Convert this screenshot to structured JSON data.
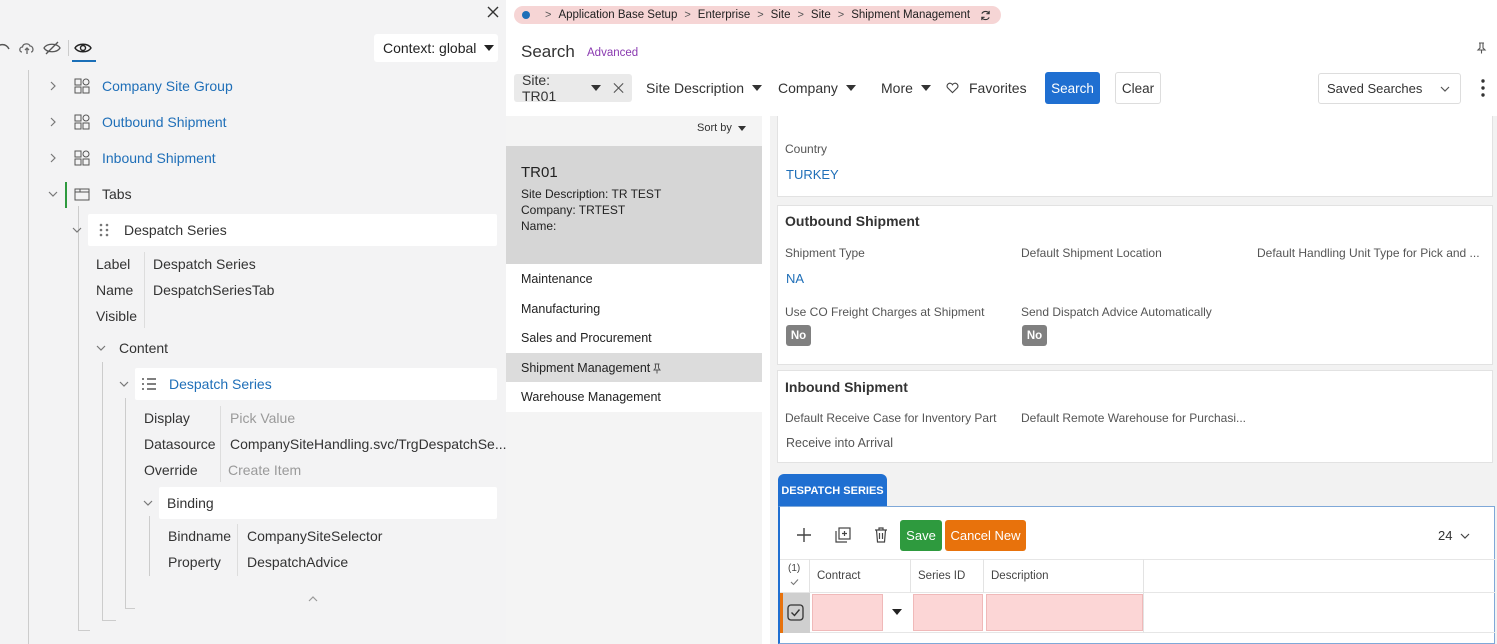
{
  "left": {
    "context_label": "Context: global",
    "tree": {
      "company_site_group": "Company Site Group",
      "outbound_shipment": "Outbound Shipment",
      "inbound_shipment": "Inbound Shipment",
      "tabs": "Tabs",
      "despatch_series": "Despatch Series",
      "props": {
        "label_key": "Label",
        "label_val": "Despatch Series",
        "name_key": "Name",
        "name_val": "DespatchSeriesTab",
        "visible_key": "Visible"
      },
      "content": "Content",
      "content_list": "Despatch Series",
      "list_props": {
        "display_key": "Display",
        "display_val": "Pick Value",
        "datasource_key": "Datasource",
        "datasource_val": "CompanySiteHandling.svc/TrgDespatchSe...",
        "override_key": "Override",
        "override_val": "Create Item"
      },
      "binding": "Binding",
      "binding_props": {
        "bindname_key": "Bindname",
        "bindname_val": "CompanySiteSelector",
        "property_key": "Property",
        "property_val": "DespatchAdvice"
      }
    }
  },
  "breadcrumb": [
    "Application Base Setup",
    "Enterprise",
    "Site",
    "Site",
    "Shipment Management"
  ],
  "search": {
    "title": "Search",
    "advanced": "Advanced",
    "site_chip": "Site: TR01",
    "site_description": "Site Description",
    "company": "Company",
    "more": "More",
    "favorites": "Favorites",
    "search_btn": "Search",
    "clear_btn": "Clear",
    "saved_searches": "Saved Searches"
  },
  "list": {
    "sort_by": "Sort by",
    "card": {
      "title": "TR01",
      "site_desc": "Site Description:  TR TEST",
      "company": "Company:  TRTEST",
      "name": "Name:"
    },
    "nav": [
      "Maintenance",
      "Manufacturing",
      "Sales and Procurement",
      "Shipment Management",
      "Warehouse Management"
    ]
  },
  "main": {
    "country_label": "Country",
    "country_value": "TURKEY",
    "outbound": {
      "title": "Outbound Shipment",
      "shipment_type_label": "Shipment Type",
      "shipment_type_value": "NA",
      "default_location_label": "Default Shipment Location",
      "default_hu_label": "Default Handling Unit Type for Pick and ...",
      "use_co_label": "Use CO Freight Charges at Shipment",
      "use_co_value": "No",
      "send_dispatch_label": "Send Dispatch Advice Automatically",
      "send_dispatch_value": "No"
    },
    "inbound": {
      "title": "Inbound Shipment",
      "receive_case_label": "Default Receive Case for Inventory Part",
      "receive_case_value": "Receive into Arrival",
      "remote_wh_label": "Default Remote Warehouse for Purchasi..."
    },
    "despatch": {
      "tab": "DESPATCH SERIES",
      "save": "Save",
      "cancel_new": "Cancel New",
      "page_size": "24",
      "selected_count": "(1)",
      "columns": [
        "Contract",
        "Series ID",
        "Description"
      ]
    }
  },
  "colors": {
    "primary": "#1f6fd1",
    "link": "#1f6fb8",
    "save": "#2e9a3e",
    "cancel": "#e8720c",
    "breadcrumb_bg": "#f6d5d5",
    "required_cell": "#fcd6d6"
  }
}
